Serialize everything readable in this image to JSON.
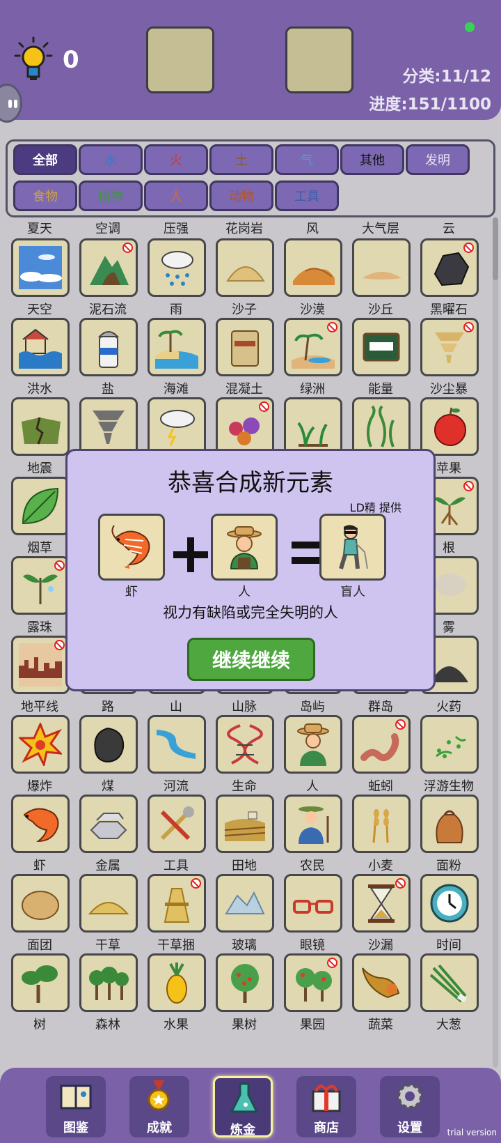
{
  "header": {
    "hint_count": "0",
    "category_count": "分类:11/12",
    "progress": "进度:151/1100"
  },
  "filters": [
    {
      "label": "全部",
      "active": true,
      "color": "#ffffff"
    },
    {
      "label": "水",
      "color": "#3a78c8"
    },
    {
      "label": "火",
      "color": "#d23a2a"
    },
    {
      "label": "土",
      "color": "#8b5a2b"
    },
    {
      "label": "气",
      "color": "#4aa0d8"
    },
    {
      "label": "其他",
      "color": "#111111"
    },
    {
      "label": "发明",
      "color": "#e9e4f2"
    },
    {
      "label": "食物",
      "color": "#c9a24a"
    },
    {
      "label": "植物",
      "color": "#3a9a3a"
    },
    {
      "label": "人",
      "color": "#d96b2a"
    },
    {
      "label": "动物",
      "color": "#b0552a"
    },
    {
      "label": "工具",
      "color": "#3c5ca8"
    }
  ],
  "top_labels": [
    "夏天",
    "空调",
    "压强",
    "花岗岩",
    "风",
    "大气层",
    "云"
  ],
  "grid": [
    [
      {
        "name": "天空",
        "icon": "sky-icon"
      },
      {
        "name": "泥石流",
        "icon": "mudslide-icon",
        "ban": true
      },
      {
        "name": "雨",
        "icon": "rain-icon"
      },
      {
        "name": "沙子",
        "icon": "sand-icon"
      },
      {
        "name": "沙漠",
        "icon": "desert-icon"
      },
      {
        "name": "沙丘",
        "icon": "dune-icon"
      },
      {
        "name": "黑曜石",
        "icon": "obsidian-icon",
        "ban": true
      }
    ],
    [
      {
        "name": "洪水",
        "icon": "flood-icon"
      },
      {
        "name": "盐",
        "icon": "salt-icon"
      },
      {
        "name": "海滩",
        "icon": "beach-icon"
      },
      {
        "name": "混凝土",
        "icon": "cement-icon"
      },
      {
        "name": "绿洲",
        "icon": "oasis-icon",
        "ban": true
      },
      {
        "name": "能量",
        "icon": "energy-icon"
      },
      {
        "name": "沙尘暴",
        "icon": "sandstorm-icon",
        "ban": true
      }
    ],
    [
      {
        "name": "地震",
        "icon": "earthquake-icon"
      },
      {
        "name": "",
        "icon": "tornado-icon"
      },
      {
        "name": "",
        "icon": "storm-icon"
      },
      {
        "name": "",
        "icon": "gems-icon",
        "ban": true
      },
      {
        "name": "",
        "icon": "plant-icon"
      },
      {
        "name": "",
        "icon": "seaweed-icon"
      },
      {
        "name": "苹果",
        "icon": "apple-icon"
      }
    ],
    [
      {
        "name": "烟草",
        "icon": "leaf-icon"
      },
      {
        "name": "",
        "icon": "blank"
      },
      {
        "name": "",
        "icon": "blank"
      },
      {
        "name": "",
        "icon": "blank"
      },
      {
        "name": "",
        "icon": "blank"
      },
      {
        "name": "",
        "icon": "blank"
      },
      {
        "name": "根",
        "icon": "root-icon",
        "ban": true
      }
    ],
    [
      {
        "name": "露珠",
        "icon": "dew-icon",
        "ban": true
      },
      {
        "name": "",
        "icon": "blank"
      },
      {
        "name": "",
        "icon": "blank"
      },
      {
        "name": "",
        "icon": "blank"
      },
      {
        "name": "",
        "icon": "blank"
      },
      {
        "name": "",
        "icon": "blank"
      },
      {
        "name": "雾",
        "icon": "fog-icon"
      }
    ],
    [
      {
        "name": "地平线",
        "icon": "skyline-icon",
        "ban": true
      },
      {
        "name": "路",
        "icon": "road-icon"
      },
      {
        "name": "山",
        "icon": "mountain-icon"
      },
      {
        "name": "山脉",
        "icon": "range-icon"
      },
      {
        "name": "岛屿",
        "icon": "island-icon"
      },
      {
        "name": "群岛",
        "icon": "archipelago-icon"
      },
      {
        "name": "火药",
        "icon": "gunpowder-icon"
      }
    ],
    [
      {
        "name": "爆炸",
        "icon": "explosion-icon"
      },
      {
        "name": "煤",
        "icon": "coal-icon"
      },
      {
        "name": "河流",
        "icon": "river-icon"
      },
      {
        "name": "生命",
        "icon": "dna-icon"
      },
      {
        "name": "人",
        "icon": "person-icon"
      },
      {
        "name": "蚯蚓",
        "icon": "worm-icon",
        "ban": true
      },
      {
        "name": "浮游生物",
        "icon": "plankton-icon"
      }
    ],
    [
      {
        "name": "虾",
        "icon": "shrimp-icon"
      },
      {
        "name": "金属",
        "icon": "metal-icon"
      },
      {
        "name": "工具",
        "icon": "tools-icon"
      },
      {
        "name": "田地",
        "icon": "field-icon"
      },
      {
        "name": "农民",
        "icon": "farmer-icon"
      },
      {
        "name": "小麦",
        "icon": "wheat-icon"
      },
      {
        "name": "面粉",
        "icon": "flour-icon"
      }
    ],
    [
      {
        "name": "面团",
        "icon": "dough-icon"
      },
      {
        "name": "干草",
        "icon": "hay-icon"
      },
      {
        "name": "干草捆",
        "icon": "haybale-icon",
        "ban": true
      },
      {
        "name": "玻璃",
        "icon": "glass-icon"
      },
      {
        "name": "眼镜",
        "icon": "glasses-icon"
      },
      {
        "name": "沙漏",
        "icon": "hourglass-icon",
        "ban": true
      },
      {
        "name": "时间",
        "icon": "clock-icon"
      }
    ],
    [
      {
        "name": "树",
        "icon": "tree-icon"
      },
      {
        "name": "森林",
        "icon": "forest-icon"
      },
      {
        "name": "水果",
        "icon": "pineapple-icon"
      },
      {
        "name": "果树",
        "icon": "fruittree-icon"
      },
      {
        "name": "果园",
        "icon": "orchard-icon",
        "ban": true
      },
      {
        "name": "蔬菜",
        "icon": "cornucopia-icon"
      },
      {
        "name": "大葱",
        "icon": "scallion-icon"
      }
    ]
  ],
  "modal": {
    "title": "恭喜合成新元素",
    "credit": "LD精 提供",
    "left": {
      "name": "虾",
      "icon": "shrimp-icon"
    },
    "right": {
      "name": "人",
      "icon": "person-icon"
    },
    "result": {
      "name": "盲人",
      "icon": "blind-person-icon"
    },
    "description": "视力有缺陷或完全失明的人",
    "button": "继续继续"
  },
  "nav": [
    {
      "label": "图鉴",
      "icon": "book-icon"
    },
    {
      "label": "成就",
      "icon": "medal-icon"
    },
    {
      "label": "炼金",
      "icon": "flask-icon",
      "active": true
    },
    {
      "label": "商店",
      "icon": "gift-icon"
    },
    {
      "label": "设置",
      "icon": "gear-icon"
    }
  ],
  "watermark": "trial version"
}
